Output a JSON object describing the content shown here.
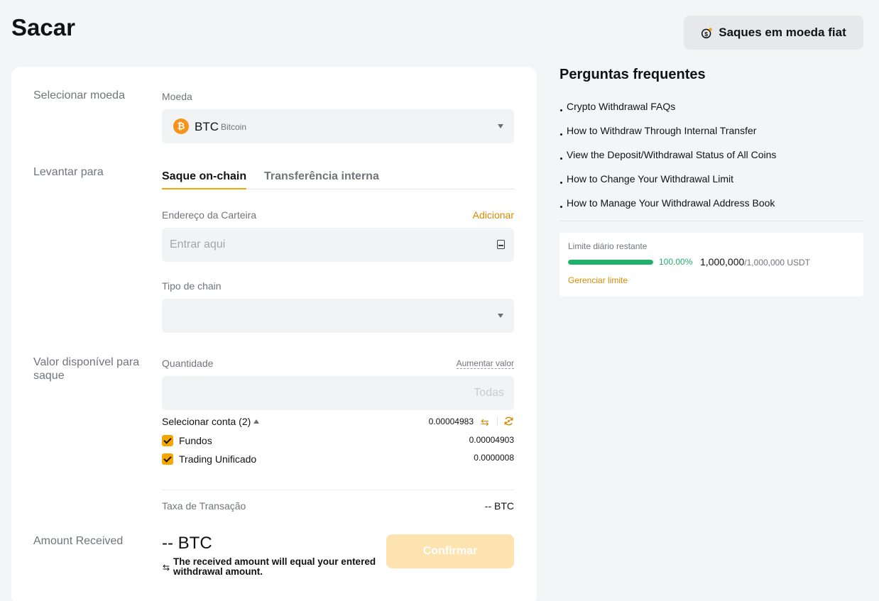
{
  "header": {
    "title": "Sacar",
    "fiat_button_label": "Saques em moeda fiat"
  },
  "form": {
    "select_coin": {
      "section_label": "Selecionar moeda",
      "field_label": "Moeda",
      "selected_symbol": "BTC",
      "selected_name": "Bitcoin",
      "icon": "bitcoin-icon",
      "icon_color": "#f7931a"
    },
    "withdraw_to": {
      "section_label": "Levantar para",
      "tabs": [
        {
          "label": "Saque on-chain",
          "active": true
        },
        {
          "label": "Transferência interna",
          "active": false
        }
      ]
    },
    "address": {
      "label": "Endereço da Carteira",
      "add_link": "Adicionar",
      "placeholder": "Entrar aqui"
    },
    "chain": {
      "label": "Tipo de chain",
      "value": ""
    },
    "available": {
      "section_label": "Valor disponível para saque",
      "quantity_label": "Quantidade",
      "increase_link": "Aumentar valor",
      "placeholder": "Todas",
      "select_account_label": "Selecionar conta (2)",
      "total_value": "0.00004983",
      "accounts": [
        {
          "label": "Fundos",
          "value": "0.00004903",
          "checked": true
        },
        {
          "label": "Trading Unificado",
          "value": "0.0000008",
          "checked": true
        }
      ]
    },
    "fee": {
      "label": "Taxa de Transação",
      "value": "-- BTC"
    },
    "received": {
      "section_label": "Amount Received",
      "amount": "-- BTC",
      "note": "The received amount will equal your entered withdrawal amount.",
      "confirm_label": "Confirmar"
    }
  },
  "faq": {
    "title": "Perguntas frequentes",
    "items": [
      "Crypto Withdrawal FAQs",
      "How to Withdraw Through Internal Transfer",
      "View the Deposit/Withdrawal Status of All Coins",
      "How to Change Your Withdrawal Limit",
      "How to Manage Your Withdrawal Address Book"
    ]
  },
  "limit": {
    "title": "Limite diário restante",
    "percent_text": "100.00%",
    "fraction": 1.0,
    "remaining": "1,000,000",
    "total": "/1,000,000 USDT",
    "manage_link": "Gerenciar limite"
  },
  "colors": {
    "accent": "#f7a600",
    "link": "#d98a00",
    "success": "#20b26c",
    "confirm_disabled": "#fde3b0"
  }
}
